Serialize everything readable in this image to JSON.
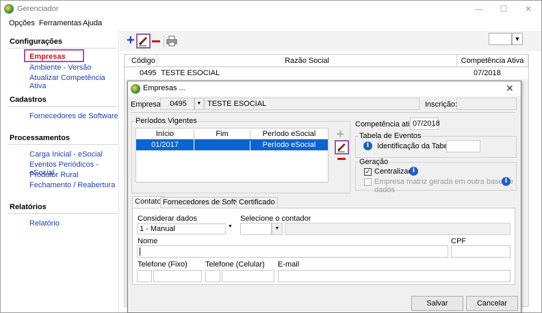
{
  "window": {
    "title": "Gerenciador"
  },
  "menu": [
    "Opções",
    "Ferramentas",
    "Ajuda"
  ],
  "sidebar": {
    "configuracoes": {
      "title": "Configurações",
      "items": [
        "Empresas",
        "Ambiente - Versão",
        "Atualizar Competência Ativa"
      ]
    },
    "cadastros": {
      "title": "Cadastros",
      "items": [
        "Fornecedores de Software"
      ]
    },
    "processamentos": {
      "title": "Processamentos",
      "items": [
        "Carga Inicial - eSocial",
        "Eventos Periódicos - eSocial",
        "Produtor Rural",
        "Fechamento / Reabertura"
      ]
    },
    "relatorios": {
      "title": "Relatórios",
      "items": [
        "Relatório"
      ]
    }
  },
  "main_grid": {
    "headers": [
      "Código",
      "Razão Social",
      "Competência Ativa"
    ],
    "rows": [
      {
        "codigo": "0495",
        "razao": "TESTE ESOCIAL",
        "competencia": "07/2018"
      }
    ]
  },
  "dialog": {
    "title": "Empresas ...",
    "empresa_label": "Empresa:",
    "empresa_code": "0495",
    "empresa_name": "TESTE ESOCIAL",
    "inscricao_label": "Inscrição:",
    "inscricao_value": "",
    "periodos": {
      "title": "Períodos Vigentes",
      "headers": [
        "Início",
        "Fim",
        "Período eSocial"
      ],
      "rows": [
        {
          "inicio": "01/2017",
          "fim": "",
          "periodo": "Período eSocial"
        }
      ]
    },
    "competencia_label": "Competência ativa:",
    "competencia_value": "07/2018",
    "tabela_eventos": {
      "title": "Tabela de Eventos",
      "label": "Identificação da Tabela",
      "value": ""
    },
    "geracao": {
      "title": "Geração",
      "centralizada": "Centralizada",
      "matriz": "Empresa matriz gerada em outra base de dados"
    },
    "tabs": [
      "Contato",
      "Fornecedores de Software",
      "Certificado"
    ],
    "contato": {
      "considerar_label": "Considerar dados",
      "considerar_value": "1 - Manual",
      "contador_label": "Selecione o contador",
      "nome_label": "Nome",
      "cpf_label": "CPF",
      "fone_fixo_label": "Telefone (Fixo)",
      "fone_cel_label": "Telefone (Celular)",
      "email_label": "E-mail"
    },
    "buttons": {
      "save": "Salvar",
      "cancel": "Cancelar"
    }
  },
  "icons": {
    "add": "plus-icon",
    "edit": "pencil-icon",
    "remove": "minus-icon",
    "print": "printer-icon",
    "info": "info-icon"
  },
  "colors": {
    "link": "#1f3fb0",
    "active": "#d4101c",
    "selection": "#0a64d2",
    "highlight": "#9b57a8"
  }
}
